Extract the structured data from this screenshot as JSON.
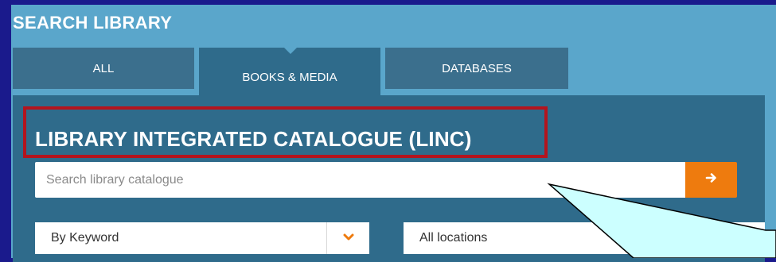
{
  "panel": {
    "title": "SEARCH LIBRARY"
  },
  "tabs": [
    {
      "label": "ALL",
      "active": false
    },
    {
      "label": "BOOKS & MEDIA",
      "active": true
    },
    {
      "label": "DATABASES",
      "active": false
    }
  ],
  "section": {
    "title": "LIBRARY INTEGRATED CATALOGUE (LINC)"
  },
  "search": {
    "placeholder": "Search library catalogue",
    "value": "",
    "button_icon": "arrow-right-icon"
  },
  "filters": {
    "search_by": "By Keyword",
    "location": "All locations"
  },
  "colors": {
    "background": "#1a1a8c",
    "panel": "#5aa6cb",
    "tab": "#3b6f8d",
    "content": "#2f6b8b",
    "accent": "#ee7b0e",
    "highlight_border": "#b3141e",
    "callout_fill": "#ccffff"
  }
}
